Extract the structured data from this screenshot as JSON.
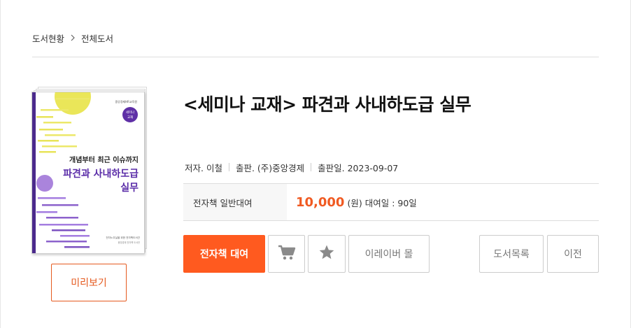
{
  "breadcrumb": {
    "home": "도서현황",
    "current": "전체도서",
    "separator_icon": "chevron-right-icon"
  },
  "book": {
    "title": "<세미나 교재> 파견과 사내하도급 실무",
    "author": "저자. 이철",
    "publisher": "출판. (주)중앙경제",
    "pub_date": "출판일. 2023-09-07",
    "cover": {
      "publisher_logo": "중앙경제HR교육원",
      "badge_line1": "세미나",
      "badge_line2": "교재",
      "subtitle": "개념부터 최근 이슈까지",
      "title_line1": "파견과 사내하도급",
      "title_line2": "실무",
      "footer_line1": "전자노무실을 위한 전자책도서관",
      "footer_line2": "중앙경제 전자책 도서관"
    }
  },
  "preview_button": "미리보기",
  "price": {
    "label": "전자책 일반대여",
    "amount": "10,000",
    "unit": "(원)",
    "period": "대여일 : 90일"
  },
  "actions": {
    "rent": "전자책 대여",
    "cart_icon": "cart-icon",
    "favorite_icon": "star-icon",
    "mall": "이레이버 몰",
    "list": "도서목록",
    "prev": "이전"
  },
  "colors": {
    "accent": "#ff5a1f",
    "price": "#f05a22",
    "cover_purple": "#6a3fb0",
    "cover_yellow": "#e6e23c"
  }
}
